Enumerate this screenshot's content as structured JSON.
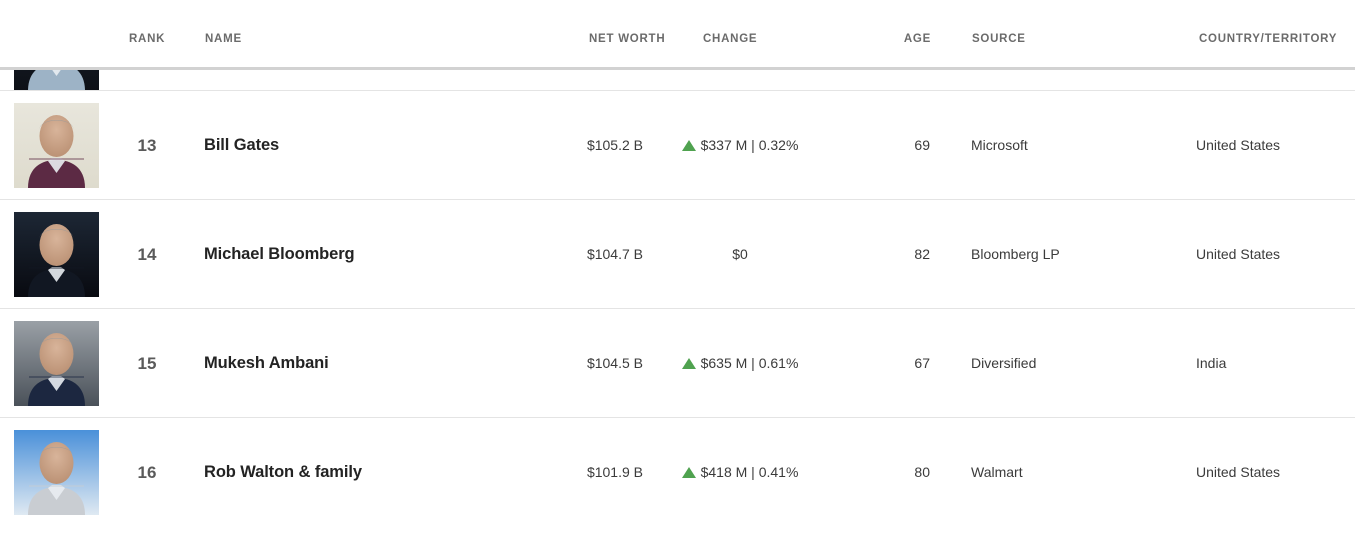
{
  "table": {
    "columns": {
      "rank": "RANK",
      "name": "NAME",
      "net_worth": "NET WORTH",
      "change": "CHANGE",
      "age": "AGE",
      "source": "SOURCE",
      "country": "COUNTRY/TERRITORY"
    },
    "accent_up_color": "#4fa24f",
    "header_text_color": "#6b6b6b",
    "divider_color": "#e4e4e4",
    "header_divider_color": "#d2d2d2",
    "rows": [
      {
        "partial": true,
        "rank": "",
        "name": "",
        "net_worth": "",
        "change": "",
        "age": "",
        "source": "",
        "country": "",
        "direction": "none",
        "photo": {
          "name": "billionaire-portrait",
          "bg_top": "#1b2430",
          "bg_bottom": "#0d1016",
          "shirt": "#9db3c6"
        }
      },
      {
        "partial": false,
        "rank": "13",
        "name": "Bill Gates",
        "net_worth": "$105.2 B",
        "change": "$337 M | 0.32%",
        "age": "69",
        "source": "Microsoft",
        "country": "United States",
        "direction": "up",
        "photo": {
          "name": "bill-gates-portrait",
          "bg_top": "#e8e6dc",
          "bg_bottom": "#dedbcd",
          "shirt": "#5c2a44"
        }
      },
      {
        "partial": false,
        "rank": "14",
        "name": "Michael Bloomberg",
        "net_worth": "$104.7 B",
        "change": "$0",
        "age": "82",
        "source": "Bloomberg LP",
        "country": "United States",
        "direction": "none",
        "photo": {
          "name": "michael-bloomberg-portrait",
          "bg_top": "#1d2735",
          "bg_bottom": "#080a10",
          "shirt": "#111722"
        }
      },
      {
        "partial": false,
        "rank": "15",
        "name": "Mukesh Ambani",
        "net_worth": "$104.5 B",
        "change": "$635 M | 0.61%",
        "age": "67",
        "source": "Diversified",
        "country": "India",
        "direction": "up",
        "photo": {
          "name": "mukesh-ambani-portrait",
          "bg_top": "#9aa0a6",
          "bg_bottom": "#4a5159",
          "shirt": "#1c2740"
        }
      },
      {
        "partial": false,
        "rank": "16",
        "name": "Rob Walton & family",
        "net_worth": "$101.9 B",
        "change": "$418 M | 0.41%",
        "age": "80",
        "source": "Walmart",
        "country": "United States",
        "direction": "up",
        "photo": {
          "name": "rob-walton-portrait",
          "bg_top": "#4a90d9",
          "bg_bottom": "#dfe9f2",
          "shirt": "#c9cdd2"
        }
      }
    ]
  }
}
